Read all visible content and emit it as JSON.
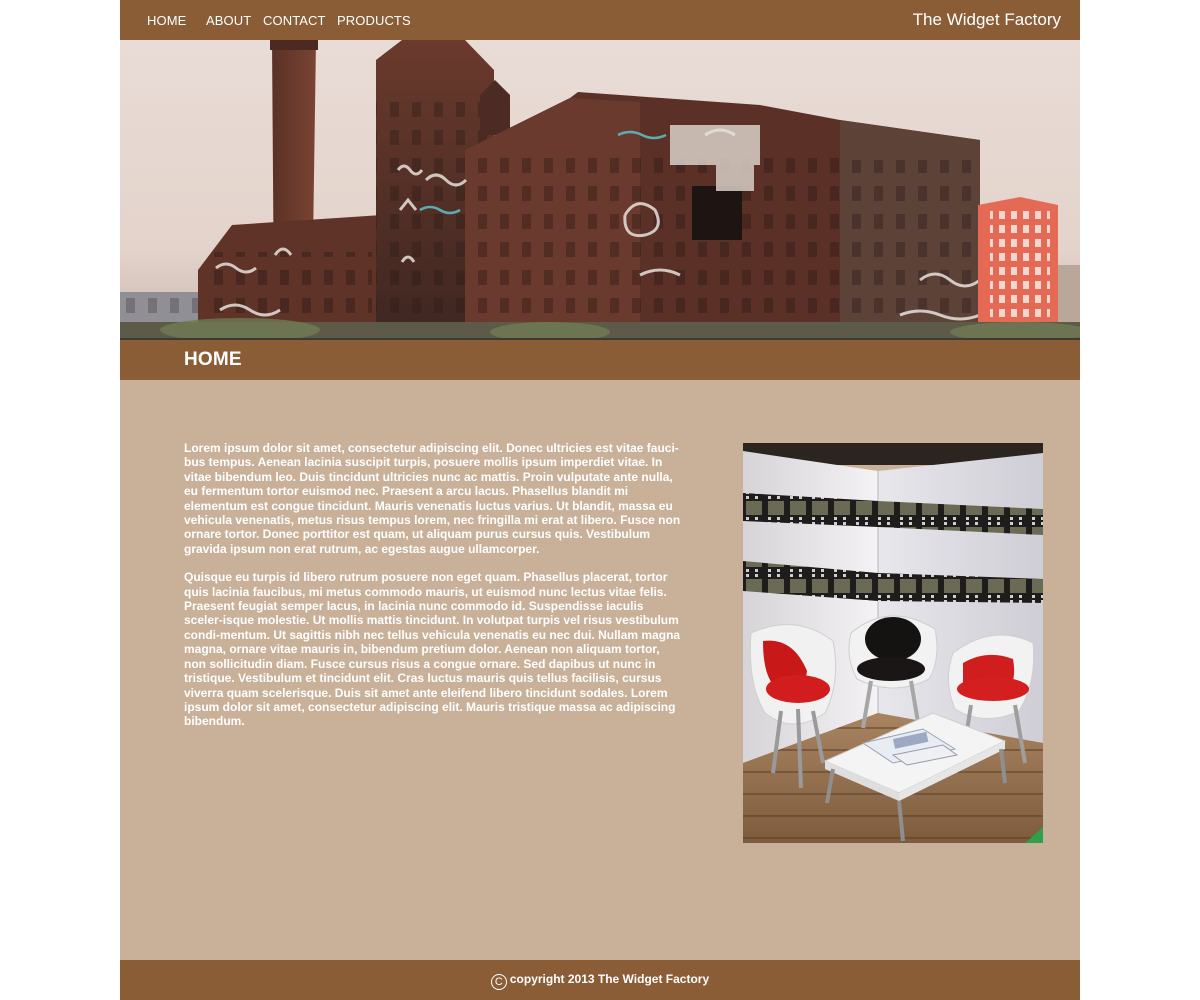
{
  "nav": {
    "items": [
      {
        "label": "HOME"
      },
      {
        "label": "ABOUT"
      },
      {
        "label": "CONTACT"
      },
      {
        "label": "PRODUCTS"
      }
    ]
  },
  "brand": "The Widget Factory",
  "page_title": "HOME",
  "content": {
    "paragraphs": [
      "Lorem ipsum dolor sit amet, consectetur adipiscing elit. Donec ultricies est vitae fauci-bus tempus. Aenean lacinia suscipit turpis, posuere mollis ipsum imperdiet vitae. In vitae bibendum leo. Duis tincidunt ultricies nunc ac mattis. Proin vulputate ante nulla, eu fermentum tortor euismod nec. Praesent a arcu lacus. Phasellus blandit mi elementum est congue tincidunt. Mauris venenatis luctus varius. Ut blandit, massa eu vehicula venenatis, metus risus tempus lorem, nec fringilla mi erat at libero. Fusce non ornare tortor. Donec porttitor est quam, ut aliquam purus cursus quis. Vestibulum gravida ipsum non erat rutrum, ac egestas augue ullamcorper.",
      "Quisque eu turpis id libero rutrum posuere non eget quam. Phasellus placerat, tortor quis lacinia faucibus, mi metus commodo mauris, ut euismod nunc lectus vitae felis. Praesent feugiat semper lacus, in lacinia nunc commodo id. Suspendisse iaculis sceler-isque molestie. Ut mollis mattis tincidunt. In volutpat turpis vel risus vestibulum condi-mentum. Ut sagittis nibh nec tellus vehicula venenatis eu nec dui. Nullam magna magna, ornare vitae mauris in, bibendum pretium dolor. Aenean non aliquam tortor, non sollicitudin diam. Fusce cursus risus a congue ornare. Sed dapibus ut nunc in tristique. Vestibulum et tincidunt elit. Cras luctus mauris quis tellus facilisis, cursus viverra quam scelerisque. Duis sit amet ante eleifend libero tincidunt sodales. Lorem ipsum dolor sit amet, consectetur adipiscing elit. Mauris tristique massa ac adipiscing bibendum."
    ]
  },
  "footer": {
    "copyright_symbol": "C",
    "text": "copyright 2013 The Widget Factory"
  },
  "colors": {
    "bar": "#8a5d37",
    "background": "#c8b198",
    "text": "#ffffff"
  },
  "icons": [
    "copyright-icon"
  ]
}
